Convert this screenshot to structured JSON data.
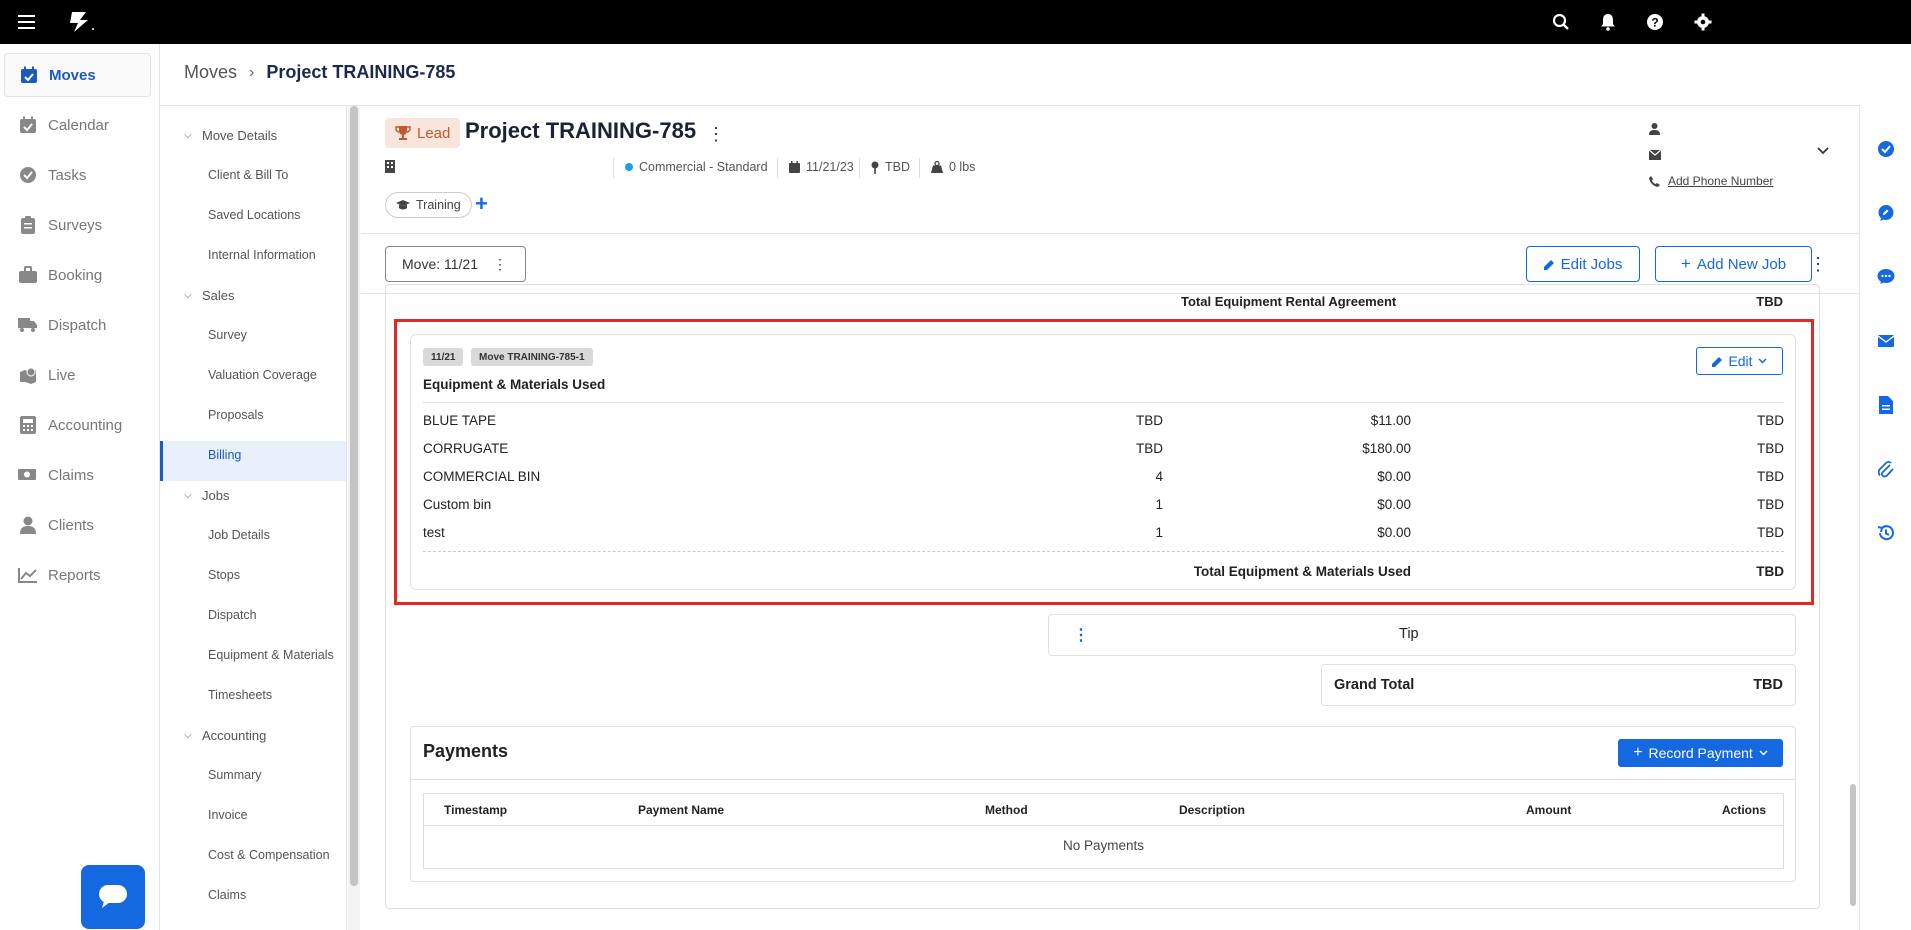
{
  "nav": {
    "items": [
      {
        "label": "Moves",
        "icon": "calendar-check-icon",
        "active": true
      },
      {
        "label": "Calendar",
        "icon": "calendar-icon"
      },
      {
        "label": "Tasks",
        "icon": "check-circle-icon"
      },
      {
        "label": "Surveys",
        "icon": "clipboard-icon"
      },
      {
        "label": "Booking",
        "icon": "briefcase-icon"
      },
      {
        "label": "Dispatch",
        "icon": "truck-icon"
      },
      {
        "label": "Live",
        "icon": "map-pin-icon"
      },
      {
        "label": "Accounting",
        "icon": "calculator-icon"
      },
      {
        "label": "Claims",
        "icon": "money-icon"
      },
      {
        "label": "Clients",
        "icon": "user-icon"
      },
      {
        "label": "Reports",
        "icon": "chart-line-icon"
      }
    ]
  },
  "breadcrumb": {
    "root": "Moves",
    "current": "Project TRAINING-785"
  },
  "subnav": {
    "sections": [
      {
        "label": "Move Details",
        "items": [
          "Client & Bill To",
          "Saved Locations",
          "Internal Information"
        ]
      },
      {
        "label": "Sales",
        "items": [
          "Survey",
          "Valuation Coverage",
          "Proposals",
          "Billing"
        ]
      },
      {
        "label": "Jobs",
        "items": [
          "Job Details",
          "Stops",
          "Dispatch",
          "Equipment & Materials",
          "Timesheets"
        ]
      },
      {
        "label": "Accounting",
        "items": [
          "Summary",
          "Invoice",
          "Cost & Compensation",
          "Claims"
        ]
      }
    ],
    "active": "Billing"
  },
  "project": {
    "status": "Lead",
    "title": "Project TRAINING-785",
    "move_type": "Commercial - Standard",
    "date": "11/21/23",
    "location": "TBD",
    "weight": "0 lbs",
    "tag": "Training",
    "add_phone": "Add Phone Number"
  },
  "jobbar": {
    "move_select": "Move: 11/21",
    "edit_jobs": "Edit Jobs",
    "add_job": "Add New Job"
  },
  "billing": {
    "prev_total_label": "Total Equipment Rental Agreement",
    "prev_total_value": "TBD",
    "materials": {
      "date_pill": "11/21",
      "move_pill": "Move TRAINING-785-1",
      "title": "Equipment & Materials Used",
      "edit_label": "Edit",
      "rows": [
        {
          "name": "BLUE TAPE",
          "qty": "TBD",
          "rate": "$11.00",
          "total": "TBD"
        },
        {
          "name": "CORRUGATE",
          "qty": "TBD",
          "rate": "$180.00",
          "total": "TBD"
        },
        {
          "name": "COMMERCIAL BIN",
          "qty": "4",
          "rate": "$0.00",
          "total": "TBD"
        },
        {
          "name": "Custom bin",
          "qty": "1",
          "rate": "$0.00",
          "total": "TBD"
        },
        {
          "name": "test",
          "qty": "1",
          "rate": "$0.00",
          "total": "TBD"
        }
      ],
      "total_label": "Total Equipment & Materials Used",
      "total_value": "TBD"
    },
    "tip_label": "Tip",
    "grand_total_label": "Grand Total",
    "grand_total_value": "TBD"
  },
  "payments": {
    "title": "Payments",
    "record_label": "Record Payment",
    "columns": [
      "Timestamp",
      "Payment Name",
      "Method",
      "Description",
      "Amount",
      "Actions"
    ],
    "empty_text": "No Payments"
  },
  "colors": {
    "accent": "#1469e0",
    "highlight": "#e02a2a",
    "lead": "#c1592e"
  }
}
